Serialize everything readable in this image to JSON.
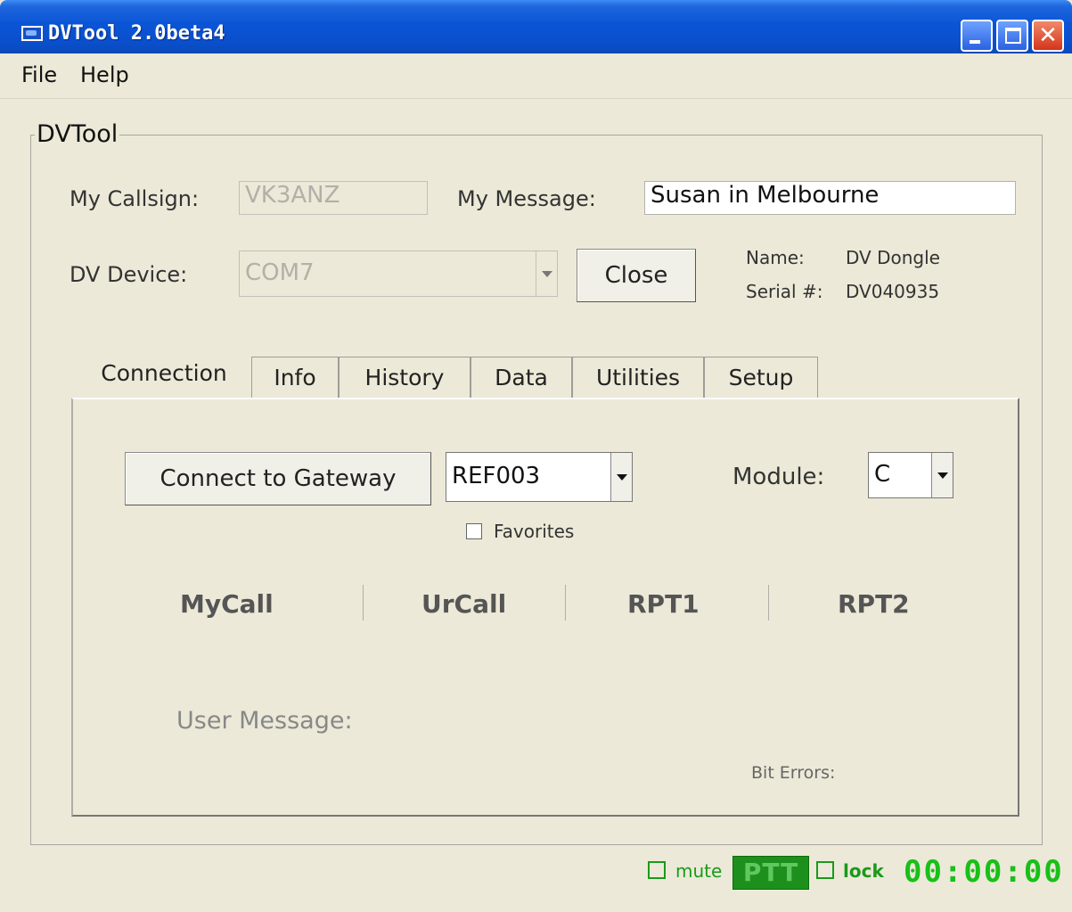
{
  "window": {
    "title": "DVTool 2.0beta4"
  },
  "menu": {
    "file": "File",
    "help": "Help"
  },
  "group": {
    "legend": "DVTool"
  },
  "callsign": {
    "label": "My Callsign:",
    "value": "VK3ANZ"
  },
  "message": {
    "label": "My Message:",
    "value": "Susan in Melbourne"
  },
  "device": {
    "label": "DV Device:",
    "value": "COM7",
    "close_button": "Close",
    "name_label": "Name:",
    "name_value": "DV Dongle",
    "serial_label": "Serial #:",
    "serial_value": "DV040935"
  },
  "tabs": [
    {
      "label": "Connection",
      "active": true
    },
    {
      "label": "Info",
      "active": false
    },
    {
      "label": "History",
      "active": false
    },
    {
      "label": "Data",
      "active": false
    },
    {
      "label": "Utilities",
      "active": false
    },
    {
      "label": "Setup",
      "active": false
    }
  ],
  "connection": {
    "connect_button": "Connect to Gateway",
    "gateway": "REF003",
    "module_label": "Module:",
    "module": "C",
    "favorites_label": "Favorites",
    "favorites_checked": false,
    "columns": [
      "MyCall",
      "UrCall",
      "RPT1",
      "RPT2"
    ],
    "user_message_label": "User Message:",
    "bit_errors_label": "Bit Errors:"
  },
  "status": {
    "mute_label": "mute",
    "mute_checked": false,
    "ptt_label": "PTT",
    "lock_label": "lock",
    "lock_checked": false,
    "timer": "00:00:00",
    "accent_color": "#18c018"
  }
}
